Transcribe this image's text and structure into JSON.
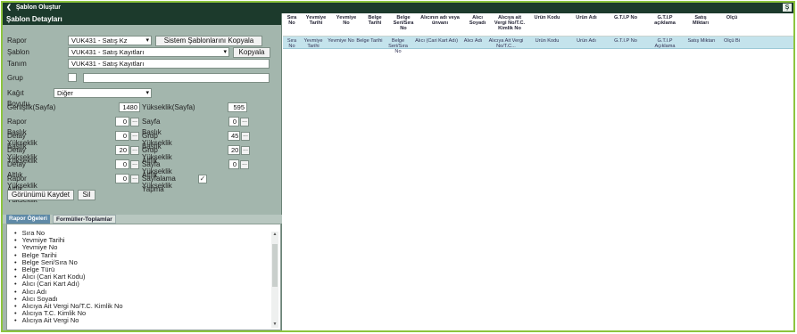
{
  "window": {
    "title": "Şablon Oluştur",
    "corner_label": "Ş"
  },
  "panel": {
    "title": "Şablon Detayları"
  },
  "form": {
    "rapor_label": "Rapor",
    "rapor_value": "VUK431 - Satış Kz",
    "sistem_button": "Sistem Şablonlarını Kopyala",
    "sablon_label": "Şablon",
    "sablon_value": "VUK431 - Satış Kayıtları",
    "kopyala_button": "Kopyala",
    "tanim_label": "Tanım",
    "tanim_value": "VUK431 - Satış Kayıtları",
    "grup_label": "Grup",
    "grup_value": "",
    "kagit_label": "Kağıt Boyutu",
    "kagit_value": "Diğer",
    "genislik_label": "Genişlik(Sayfa)",
    "genislik_value": "1480",
    "yukseklik_label": "Yükseklik(Sayfa)",
    "yukseklik_value": "595",
    "rapor_baslik_label": "Rapor Başlık Yükseklik",
    "rapor_baslik_value": "0",
    "sayfa_baslik_label": "Sayfa Başlık Yükseklik",
    "sayfa_baslik_value": "0",
    "detay_baslik_label": "Detay Başlık Yükseklik",
    "detay_baslik_value": "0",
    "grup_baslik_label": "Grup Başlık Yükseklik",
    "grup_baslik_value": "45",
    "detay_yuk_label": "Detay Yükseklik",
    "detay_yuk_value": "20",
    "grup_altlik_label": "Grup Altlık Yükseklik",
    "grup_altlik_value": "20",
    "detay_altlik_label": "Detay Altlık Yükseklik",
    "detay_altlik_value": "0",
    "sayfa_altlik_label": "Sayfa Altlık Yükseklik",
    "sayfa_altlik_value": "0",
    "rapor_altlik_label": "Rapor Altlık Yükseklik",
    "rapor_altlik_value": "0",
    "sayfalama_label": "Sayfalama Yapma",
    "sayfalama_checked": true,
    "dots": "...",
    "gorunum_button": "Görünümü Kaydet",
    "sil_button": "Sil"
  },
  "tabs": [
    "Rapor Öğeleri",
    "Formüller-Toplamlar"
  ],
  "fields": [
    "Sıra No",
    "Yevmiye Tarihi",
    "Yevmiye No",
    "Belge Tarihi",
    "Belge Seri/Sıra No",
    "Belge Türü",
    "Alıcı (Cari Kart Kodu)",
    "Alıcı (Cari Kart Adı)",
    "Alıcı Adı",
    "Alıcı Soyadı",
    "Alıcıya Ait Vergi No/T.C. Kimlik No",
    "Alıcıya T.C. Kimlik No",
    "Alıcıya Ait Vergi No"
  ],
  "columns": [
    "Sıra No",
    "Yevmiye Tarihi",
    "Yevmiye No",
    "Belge Tarihi",
    "Belge Seri/Sıra No",
    "Alıcının adı veya ünvanı",
    "Alıcı Soyadı",
    "Alıcıya ait Vergi No/T.C. Kimlik No",
    "Ürün Kodu",
    "Ürün Adı",
    "G.T.İ.P No",
    "G.T.İ.P açıklama",
    "Satış Miktarı",
    "Ölçü"
  ],
  "preview": [
    "Sıra No",
    "Yevmiye Tarihi",
    "Yevmiye No",
    "Belge Tarihi",
    "Belge Seri/Sıra No",
    "Alıcı (Cari Kart Adı)",
    "Alıcı Adı",
    "Alıcıya Ait Vergi No/T.C...",
    "Ürün Kodu",
    "Ürün Adı",
    "G.T.İ.P No",
    "G.T.İ.P Açıklama",
    "Satış Miktarı",
    "Ölçü Bi"
  ]
}
